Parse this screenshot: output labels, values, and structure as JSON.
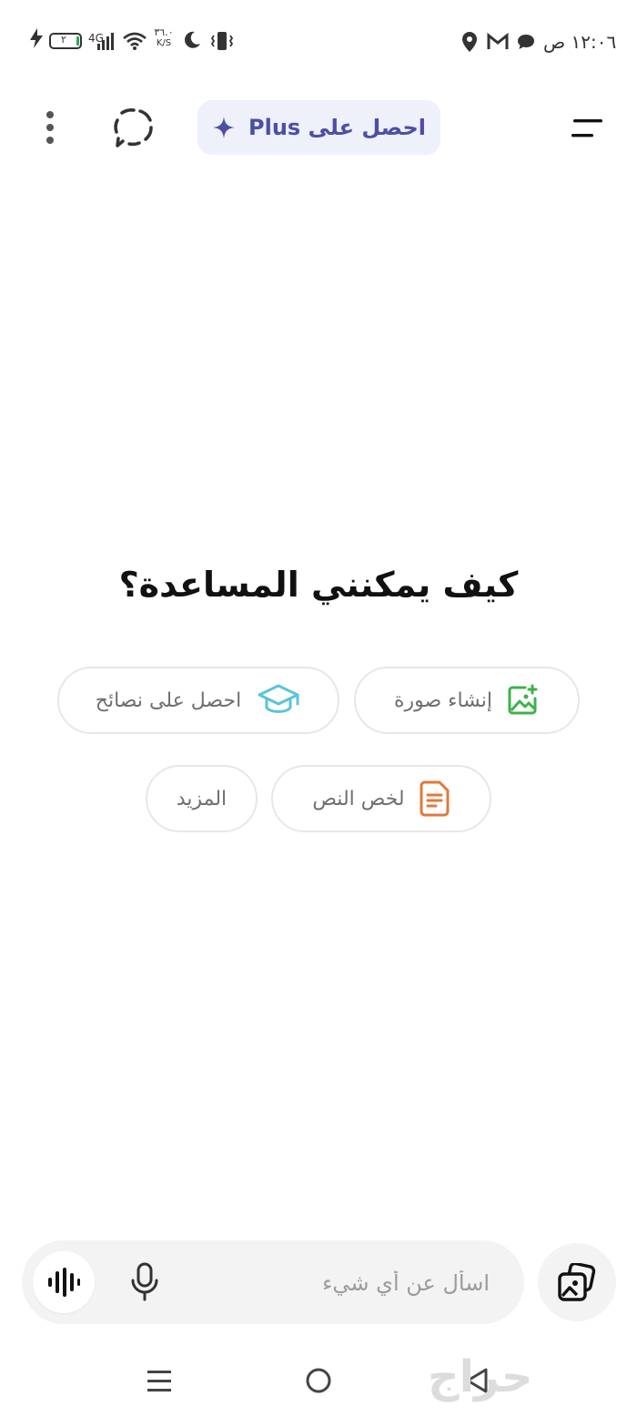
{
  "status_bar": {
    "time": "١٢:٠٦ ص",
    "battery": "٢",
    "network": "4G",
    "speed_value": "٣٦.٠",
    "speed_unit": "K/S"
  },
  "header": {
    "plus_label": "احصل على Plus"
  },
  "main": {
    "headline": "كيف يمكنني المساعدة؟",
    "chips": [
      {
        "label": "إنشاء صورة",
        "icon": "image-icon"
      },
      {
        "label": "احصل على نصائح",
        "icon": "graduation-cap-icon"
      },
      {
        "label": "لخص النص",
        "icon": "document-icon"
      },
      {
        "label": "المزيد"
      }
    ]
  },
  "composer": {
    "placeholder": "اسأل عن أي شيء"
  },
  "watermark": "حراج",
  "colors": {
    "accent": "#4c4fa5",
    "image_chip_icon": "#3db24b",
    "advice_chip_icon": "#5bc3dd",
    "doc_chip_icon": "#e07a3b"
  }
}
